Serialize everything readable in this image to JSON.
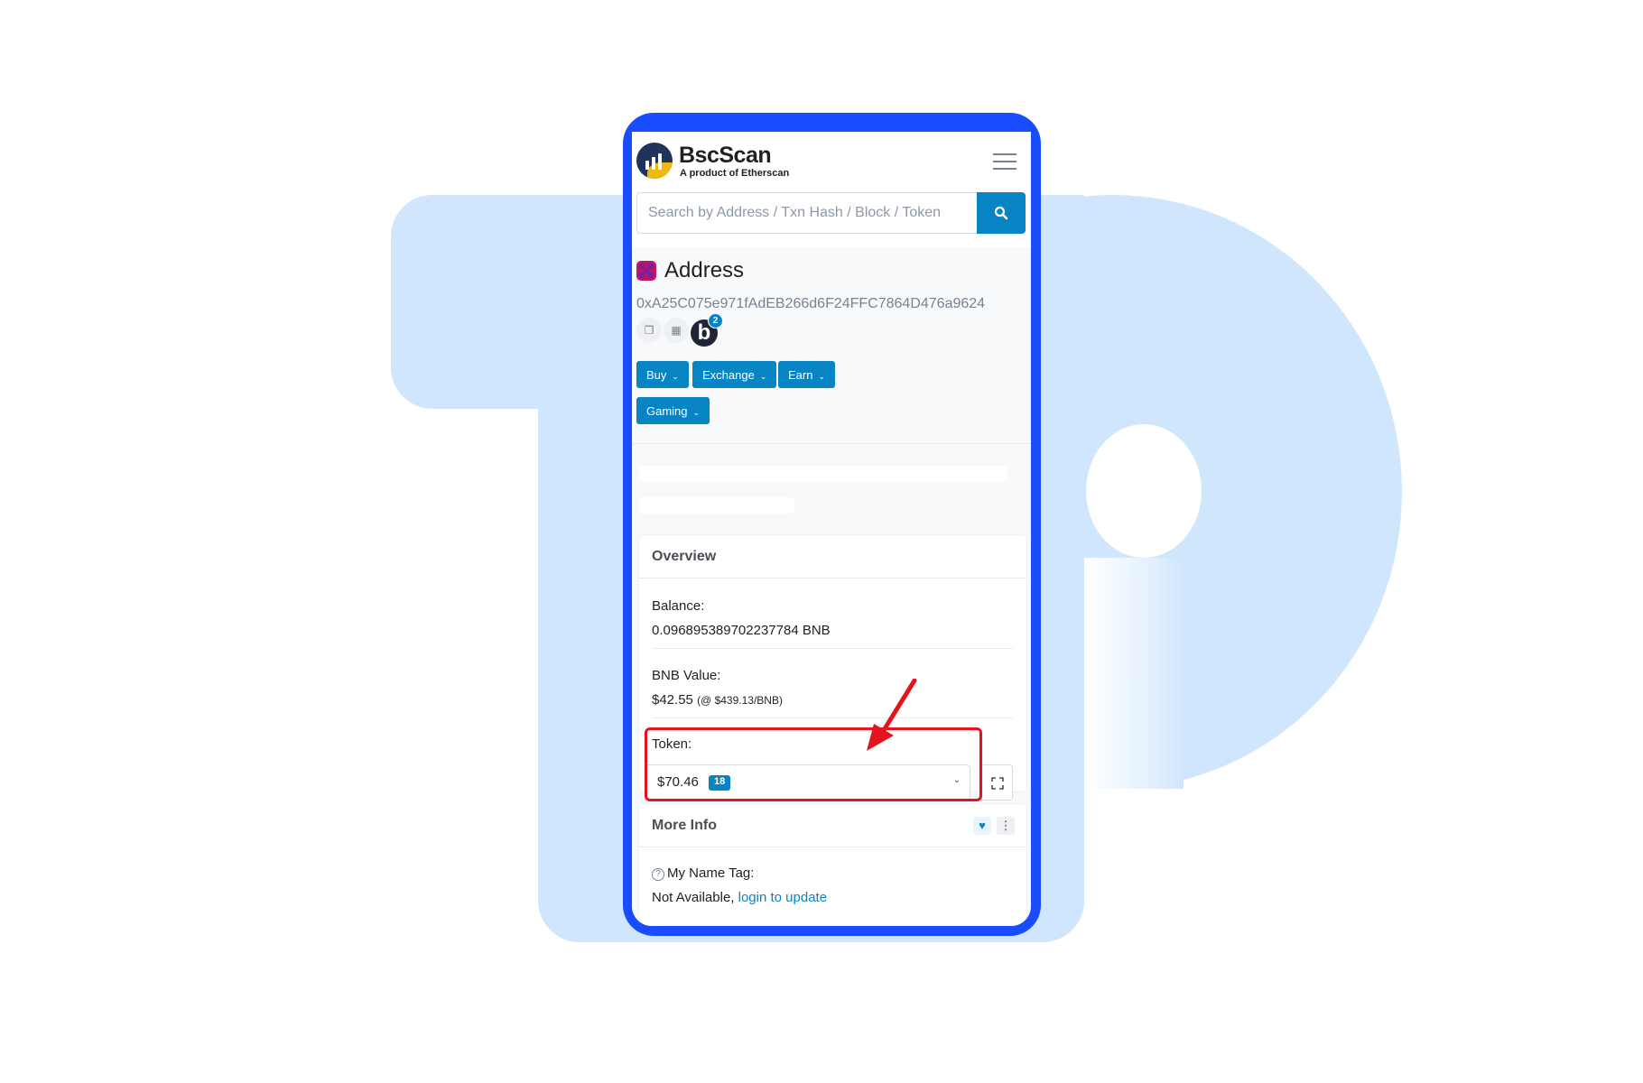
{
  "app": {
    "brand": "BscScan",
    "brand_subtitle": "A product of Etherscan"
  },
  "search": {
    "placeholder": "Search by Address / Txn Hash / Block / Token"
  },
  "address": {
    "title": "Address",
    "hash": "0xA25C075e971fAdEB266d6F24FFC7864D476a9624",
    "badge_letter": "b",
    "badge_count": "2"
  },
  "actions": [
    {
      "label": "Buy"
    },
    {
      "label": "Exchange"
    },
    {
      "label": "Earn"
    },
    {
      "label": "Gaming"
    }
  ],
  "overview": {
    "title": "Overview",
    "balance_label": "Balance:",
    "balance_value": "0.096895389702237784 BNB",
    "bnb_value_label": "BNB Value:",
    "bnb_value": "$42.55",
    "bnb_rate": "(@ $439.13/BNB)",
    "token_label": "Token:",
    "token_value": "$70.46",
    "token_count": "18"
  },
  "more_info": {
    "title": "More Info",
    "name_tag_label": "My Name Tag:",
    "name_tag_value": "Not Available,",
    "login_link": "login to update"
  },
  "colors": {
    "accent": "#0784c3",
    "phone_frame": "#1a4cff",
    "annotation": "#e3131f",
    "background_logo": "#cfe6fc"
  }
}
